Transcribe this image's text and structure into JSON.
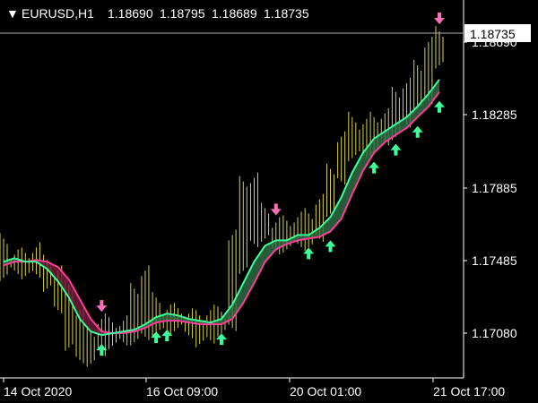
{
  "window": {
    "symbol_timeframe": "EURUSD,H1",
    "ohlc": [
      "1.18690",
      "1.18795",
      "1.18689",
      "1.18735"
    ],
    "menu_icon": "triangle-down-icon"
  },
  "price_axis": {
    "current_price": "1.18735",
    "tick_labels": [
      "1.18690",
      "1.18285",
      "1.17885",
      "1.17485",
      "1.17080"
    ]
  },
  "time_axis": {
    "tick_labels": [
      "14 Oct 2020",
      "16 Oct 09:00",
      "20 Oct 01:00",
      "21 Oct 17:00"
    ]
  },
  "colors": {
    "background": "#000000",
    "candles": "#d8d24a",
    "fast_line": "#3dff9a",
    "slow_line": "#ff3d9a",
    "bull_fill": "#2f6b44",
    "bear_fill": "#6e1a3a",
    "buy_arrow": "#3dff9a",
    "sell_arrow": "#ff6fb5",
    "axis": "#ffffff",
    "price_line": "#b0b0b0"
  },
  "chart_data": {
    "type": "line",
    "symbol": "EURUSD",
    "timeframe": "H1",
    "ylim": [
      1.1685,
      1.1878
    ],
    "x": [
      "14 Oct 2020",
      "16 Oct 09:00",
      "20 Oct 01:00",
      "21 Oct 17:00"
    ],
    "series": [
      {
        "values": [
          1.1745,
          1.1747,
          1.1745,
          1.1745,
          1.1741,
          1.1734,
          1.1725,
          1.1713,
          1.1706,
          1.1704,
          1.1705,
          1.1706,
          1.1707,
          1.171,
          1.1714,
          1.1716,
          1.1715,
          1.1713,
          1.1712,
          1.1711,
          1.1713,
          1.1721,
          1.1733,
          1.1745,
          1.1754,
          1.1757,
          1.1757,
          1.176,
          1.176,
          1.1764,
          1.177,
          1.1781,
          1.1795,
          1.1806,
          1.1814,
          1.1818,
          1.1822,
          1.1826,
          1.1832,
          1.1839,
          1.1847
        ]
      },
      {
        "values": [
          1.1743,
          1.1745,
          1.1745,
          1.1746,
          1.1745,
          1.1742,
          1.1735,
          1.1724,
          1.1713,
          1.1706,
          1.1705,
          1.1705,
          1.1706,
          1.1708,
          1.1711,
          1.1712,
          1.1712,
          1.1711,
          1.171,
          1.171,
          1.171,
          1.1713,
          1.1722,
          1.1733,
          1.1745,
          1.1752,
          1.1755,
          1.1757,
          1.1758,
          1.1759,
          1.1762,
          1.1769,
          1.1783,
          1.1796,
          1.1806,
          1.1812,
          1.1816,
          1.182,
          1.1826,
          1.1832,
          1.184
        ]
      }
    ],
    "buy_signals": [
      9,
      14,
      15,
      20,
      28,
      30,
      34,
      36,
      38,
      40
    ],
    "sell_signals": [
      9,
      25,
      40
    ],
    "candles_high": [
      1.1758,
      1.1749,
      1.175,
      1.1753,
      1.1746,
      1.174,
      1.1732,
      1.1718,
      1.1706,
      1.1713,
      1.1711,
      1.1712,
      1.173,
      1.174,
      1.1725,
      1.1718,
      1.1719,
      1.1716,
      1.1715,
      1.1718,
      1.1717,
      1.176,
      1.179,
      1.1792,
      1.1775,
      1.1767,
      1.1768,
      1.177,
      1.1772,
      1.178,
      1.1797,
      1.1815,
      1.1826,
      1.1822,
      1.1826,
      1.1828,
      1.184,
      1.1845,
      1.1855,
      1.1868,
      1.1874
    ],
    "candles_low": [
      1.1736,
      1.174,
      1.1737,
      1.1738,
      1.173,
      1.1718,
      1.1697,
      1.169,
      1.1688,
      1.1694,
      1.1698,
      1.17,
      1.17,
      1.1703,
      1.1705,
      1.1706,
      1.1708,
      1.1704,
      1.1699,
      1.1701,
      1.1705,
      1.1708,
      1.174,
      1.1755,
      1.1758,
      1.1751,
      1.1752,
      1.1755,
      1.1753,
      1.1758,
      1.1772,
      1.179,
      1.1803,
      1.1805,
      1.1806,
      1.1812,
      1.1815,
      1.1822,
      1.183,
      1.1835,
      1.1855
    ]
  }
}
